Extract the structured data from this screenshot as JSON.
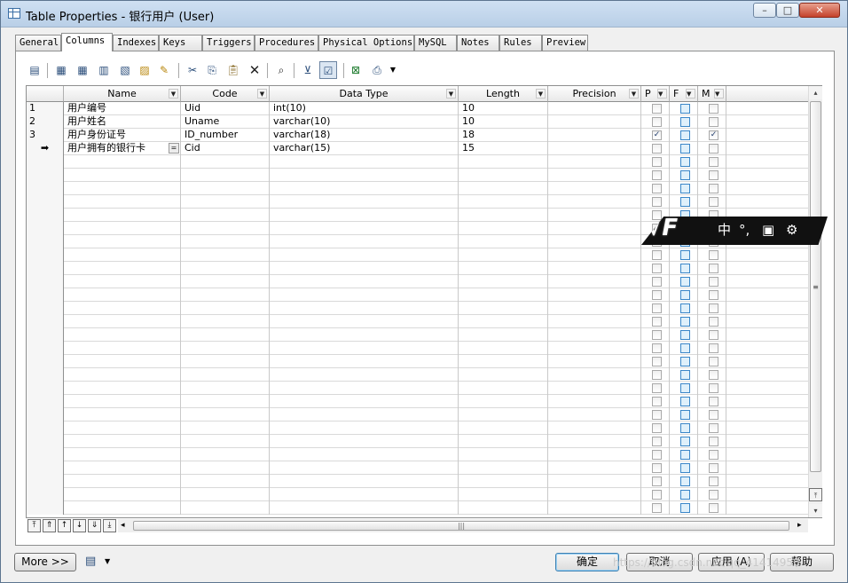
{
  "window": {
    "title": "Table Properties - 银行用户 (User)"
  },
  "window_buttons": {
    "minimize": "–",
    "maximize": "□",
    "close": "✕"
  },
  "tabs": [
    "General",
    "Columns",
    "Indexes",
    "Keys",
    "Triggers",
    "Procedures",
    "Physical Options",
    "MySQL",
    "Notes",
    "Rules",
    "Preview"
  ],
  "active_tab": "Columns",
  "toolbar": [
    "properties-icon",
    "add-row-icon",
    "insert-row-icon",
    "add-rows-icon",
    "insert-rows-icon",
    "add-column-icon",
    "auto-fill-icon",
    "cut-icon",
    "copy-icon",
    "paste-icon",
    "delete-icon",
    "find-icon",
    "filter-icon",
    "customize-columns-icon",
    "excel-export-icon",
    "print-icon",
    "dropdown-arrow-icon"
  ],
  "grid": {
    "headers": {
      "name": "Name",
      "code": "Code",
      "data_type": "Data Type",
      "length": "Length",
      "precision": "Precision",
      "p": "P",
      "f": "F",
      "m": "M"
    },
    "rows": [
      {
        "num": "1",
        "name": "用户编号",
        "code": "Uid",
        "data_type": "int(10)",
        "length": "10",
        "precision": "",
        "p": false,
        "f": false,
        "m": false
      },
      {
        "num": "2",
        "name": "用户姓名",
        "code": "Uname",
        "data_type": "varchar(10)",
        "length": "10",
        "precision": "",
        "p": false,
        "f": false,
        "m": false
      },
      {
        "num": "3",
        "name": "用户身份证号",
        "code": "ID_number",
        "data_type": "varchar(18)",
        "length": "18",
        "precision": "",
        "p": true,
        "f": false,
        "m": true
      },
      {
        "num": "➡",
        "name": "用户拥有的银行卡",
        "code": "Cid",
        "data_type": "varchar(15)",
        "length": "15",
        "precision": "",
        "p": false,
        "f": false,
        "m": false
      }
    ],
    "current_row_marker": "➡",
    "edit_button": "="
  },
  "nav_buttons": [
    "move-top-icon",
    "move-up-page-icon",
    "move-up-icon",
    "move-down-icon",
    "move-down-page-icon",
    "move-bottom-icon"
  ],
  "nav_glyphs": [
    "⤒",
    "⇑",
    "↑",
    "↓",
    "⇓",
    "⤓"
  ],
  "scroll": {
    "left": "◂",
    "right": "▸",
    "up": "▴",
    "down": "▾",
    "grip_h": "|||",
    "grip_v": "≡"
  },
  "footer": {
    "more": "More >>",
    "ok": "确定",
    "cancel": "取消",
    "apply": "应用 (A)",
    "help": "帮助"
  },
  "ime": {
    "lang": "中",
    "punct": "°,"
  },
  "watermark": "https://blog.csdn.net/qq_41414958",
  "colors": {
    "accent": "#3a86c8",
    "title_bar": "#b9cfe7",
    "panel": "#ffffff"
  }
}
